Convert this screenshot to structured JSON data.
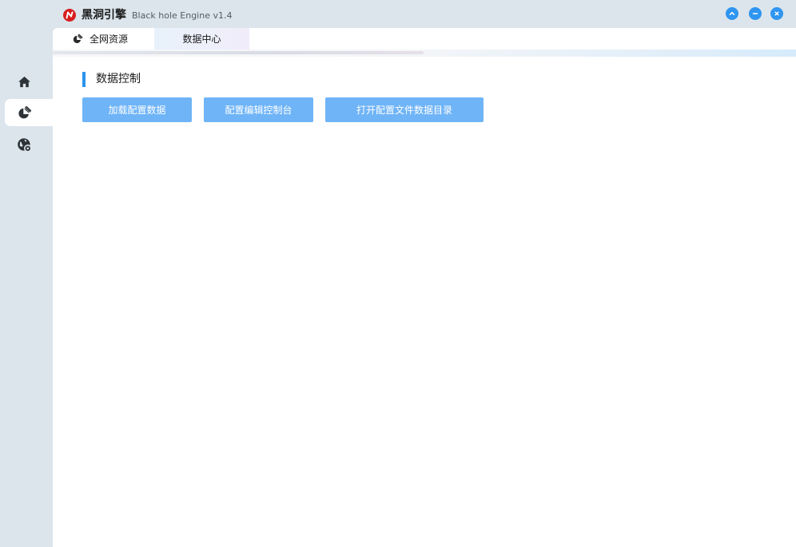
{
  "app": {
    "name": "黑洞引擎",
    "version": "Black hole Engine v1.4"
  },
  "window_controls": {
    "collapse": "chevron-up-icon",
    "minimize": "minus-icon",
    "close": "close-icon",
    "color": "#2f95f0"
  },
  "tabs": [
    {
      "label": "全网资源",
      "icon": "pie-chart-brush-icon"
    },
    {
      "label": "数据中心",
      "active": true
    }
  ],
  "sidebar": {
    "items": [
      {
        "icon": "home-icon"
      },
      {
        "icon": "pie-chart-brush-icon",
        "active": true
      },
      {
        "icon": "globe-gear-icon"
      }
    ]
  },
  "main": {
    "section_title": "数据控制",
    "buttons": [
      {
        "label": "加载配置数据"
      },
      {
        "label": "配置编辑控制台"
      },
      {
        "label": "打开配置文件数据目录"
      }
    ]
  },
  "colors": {
    "accent": "#2b93ee",
    "button": "#6fb4f7",
    "sidebar_bg": "#dce5ec",
    "logo": "#d81e1e"
  }
}
